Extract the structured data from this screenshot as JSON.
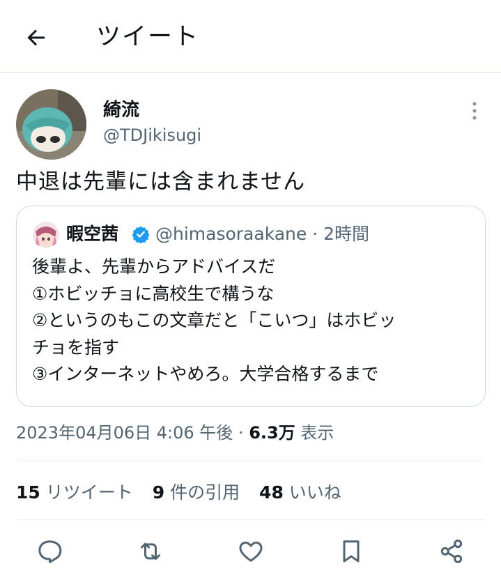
{
  "header": {
    "title": "ツイート"
  },
  "tweet": {
    "display_name": "綺流",
    "handle": "@TDJikisugi",
    "text": "中退は先輩には含まれません"
  },
  "quoted_tweet": {
    "display_name": "暇空茜",
    "handle": "@himasoraakane",
    "separator": "·",
    "time_ago": "2時間",
    "lines": [
      "後輩よ、先輩からアドバイスだ",
      "①ホビッチョに高校生で構うな",
      "②というのもこの文章だと「こいつ」はホビッ",
      "チョを指す",
      "③インターネットやめろ。大学合格するまで"
    ]
  },
  "meta": {
    "timestamp": "2023年04月06日 4:06 午後",
    "separator": "·",
    "views_count": "6.3万",
    "views_label": "表示"
  },
  "stats": {
    "retweets_count": "15",
    "retweets_label": "リツイート",
    "quotes_count": "9",
    "quotes_label": "件の引用",
    "likes_count": "48",
    "likes_label": "いいね"
  },
  "colors": {
    "text": "#0f1419",
    "secondary": "#536471",
    "border": "#cfd9de",
    "verified": "#1d9bf0"
  },
  "icons": {
    "back": "arrow-left-icon",
    "more": "more-vertical-icon",
    "verified": "verified-badge-icon",
    "reply": "reply-icon",
    "retweet": "retweet-icon",
    "like": "heart-icon",
    "bookmark": "bookmark-icon",
    "share": "share-icon"
  }
}
